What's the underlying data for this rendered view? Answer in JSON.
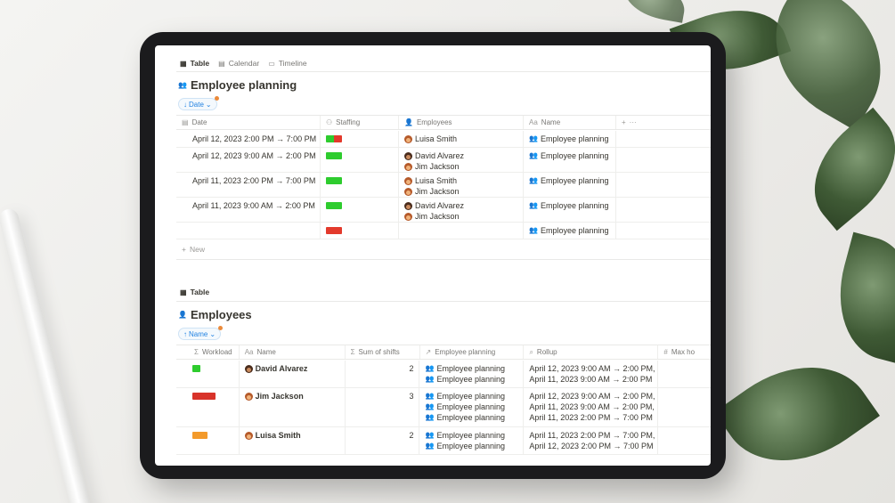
{
  "view_tabs": [
    {
      "label": "Table",
      "icon": "table-icon"
    },
    {
      "label": "Calendar",
      "icon": "calendar-icon"
    },
    {
      "label": "Timeline",
      "icon": "timeline-icon"
    }
  ],
  "planning": {
    "title": "Employee planning",
    "sort_label": "Date",
    "columns": [
      "Date",
      "Staffing",
      "Employees",
      "Name"
    ],
    "rows": [
      {
        "date": "April 12, 2023 2:00 PM → 7:00 PM",
        "staffing": "split",
        "employees": [
          "Luisa Smith"
        ],
        "name": "Employee planning"
      },
      {
        "date": "April 12, 2023 9:00 AM → 2:00 PM",
        "staffing": "green",
        "employees": [
          "David Alvarez",
          "Jim Jackson"
        ],
        "name": "Employee planning"
      },
      {
        "date": "April 11, 2023 2:00 PM → 7:00 PM",
        "staffing": "green",
        "employees": [
          "Luisa Smith",
          "Jim Jackson"
        ],
        "name": "Employee planning"
      },
      {
        "date": "April 11, 2023 9:00 AM → 2:00 PM",
        "staffing": "green",
        "employees": [
          "David Alvarez",
          "Jim Jackson"
        ],
        "name": "Employee planning"
      },
      {
        "date": "",
        "staffing": "red",
        "employees": [],
        "name": "Employee planning"
      }
    ],
    "new_label": "New"
  },
  "employees_tab": {
    "label": "Table"
  },
  "employees": {
    "title": "Employees",
    "sort_label": "Name",
    "columns": [
      "Workload",
      "Name",
      "Sum of shifts",
      "Employee planning",
      "Rollup",
      "Max ho"
    ],
    "rows": [
      {
        "workload": "green",
        "name": "David Alvarez",
        "sum": "2",
        "planning": [
          "Employee planning",
          "Employee planning"
        ],
        "rollup": [
          "April 12, 2023 9:00 AM → 2:00 PM,",
          "April 11, 2023 9:00 AM → 2:00 PM"
        ]
      },
      {
        "workload": "red",
        "name": "Jim Jackson",
        "sum": "3",
        "planning": [
          "Employee planning",
          "Employee planning",
          "Employee planning"
        ],
        "rollup": [
          "April 12, 2023 9:00 AM → 2:00 PM,",
          "April 11, 2023 9:00 AM → 2:00 PM,",
          "April 11, 2023 2:00 PM → 7:00 PM"
        ]
      },
      {
        "workload": "orange",
        "name": "Luisa Smith",
        "sum": "2",
        "planning": [
          "Employee planning",
          "Employee planning"
        ],
        "rollup": [
          "April 11, 2023 2:00 PM → 7:00 PM,",
          "April 12, 2023 2:00 PM → 7:00 PM"
        ]
      }
    ]
  },
  "colors": {
    "staffing_green": "#2ecc2e",
    "staffing_red": "#e33a2c",
    "workload_orange": "#f39a2b",
    "accent": "#2383e2"
  }
}
